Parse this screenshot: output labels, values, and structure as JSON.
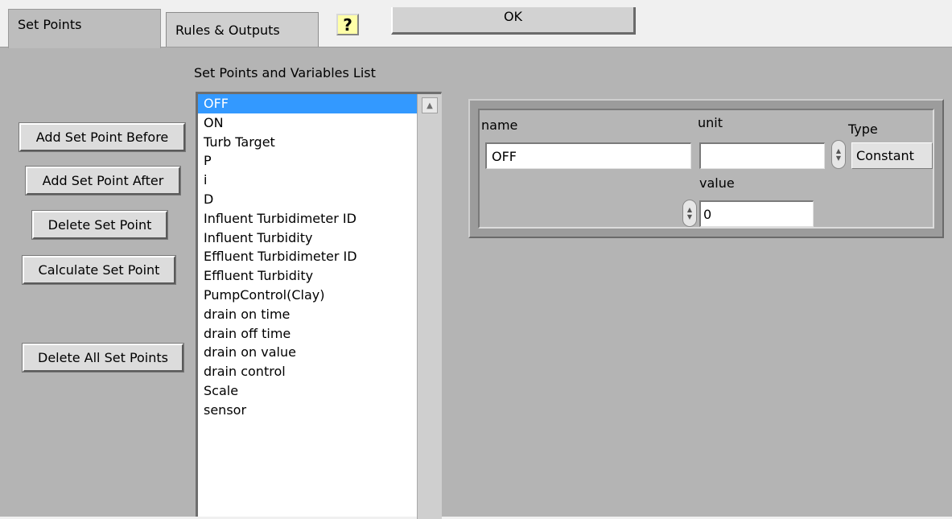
{
  "tabs": [
    {
      "label": "Set Points"
    },
    {
      "label": "Rules & Outputs"
    }
  ],
  "help_icon": "question-mark-icon",
  "ok_button": {
    "label": "OK"
  },
  "actions": {
    "add_before": "Add Set Point Before",
    "add_after": "Add Set Point After",
    "delete": "Delete Set Point",
    "calculate": "Calculate Set Point",
    "delete_all": "Delete All Set Points"
  },
  "list": {
    "title": "Set Points and Variables List",
    "selected": "OFF",
    "items": [
      "OFF",
      "ON",
      "Turb Target",
      "P",
      "i",
      "D",
      "Influent Turbidimeter ID",
      "Influent Turbidity",
      "Effluent Turbidimeter ID",
      "Effluent Turbidity",
      "PumpControl(Clay)",
      "drain on time",
      "drain off time",
      "drain on value",
      "drain control",
      "Scale",
      "sensor"
    ]
  },
  "details": {
    "name_label": "name",
    "name_value": "OFF",
    "unit_label": "unit",
    "unit_value": "",
    "type_label": "Type",
    "type_value": "Constant",
    "value_label": "value",
    "value_value": "0"
  },
  "colors": {
    "panel_bg": "#b4b4b4",
    "selection": "#3399ff",
    "help_bg": "#ffffa8"
  }
}
